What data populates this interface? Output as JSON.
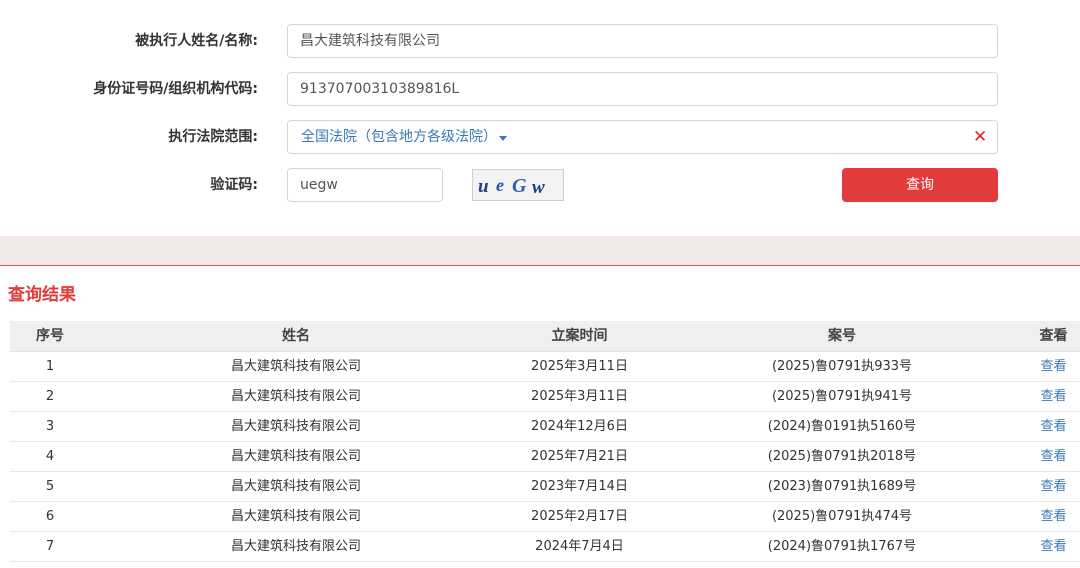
{
  "form": {
    "name_label": "被执行人姓名/名称:",
    "name_value": "昌大建筑科技有限公司",
    "id_label": "身份证号码/组织机构代码:",
    "id_value": "91370700310389816L",
    "court_label": "执行法院范围:",
    "court_value": "全国法院（包含地方各级法院）",
    "captcha_label": "验证码:",
    "captcha_value": "uegw",
    "captcha_image_text": "ueGw",
    "search_label": "查询",
    "clear_icon": "close-icon"
  },
  "results": {
    "title": "查询结果",
    "columns": [
      "序号",
      "姓名",
      "立案时间",
      "案号",
      "查看"
    ],
    "rows": [
      {
        "no": "1",
        "name": "昌大建筑科技有限公司",
        "date": "2025年3月11日",
        "case": "(2025)鲁0791执933号",
        "view": "查看"
      },
      {
        "no": "2",
        "name": "昌大建筑科技有限公司",
        "date": "2025年3月11日",
        "case": "(2025)鲁0791执941号",
        "view": "查看"
      },
      {
        "no": "3",
        "name": "昌大建筑科技有限公司",
        "date": "2024年12月6日",
        "case": "(2024)鲁0191执5160号",
        "view": "查看"
      },
      {
        "no": "4",
        "name": "昌大建筑科技有限公司",
        "date": "2025年7月21日",
        "case": "(2025)鲁0791执2018号",
        "view": "查看"
      },
      {
        "no": "5",
        "name": "昌大建筑科技有限公司",
        "date": "2023年7月14日",
        "case": "(2023)鲁0791执1689号",
        "view": "查看"
      },
      {
        "no": "6",
        "name": "昌大建筑科技有限公司",
        "date": "2025年2月17日",
        "case": "(2025)鲁0791执474号",
        "view": "查看"
      },
      {
        "no": "7",
        "name": "昌大建筑科技有限公司",
        "date": "2024年7月4日",
        "case": "(2024)鲁0791执1767号",
        "view": "查看"
      }
    ]
  },
  "colors": {
    "accent_red": "#e23b3b",
    "link_blue": "#3a7ab8",
    "band_pink": "#f2e8e8"
  }
}
